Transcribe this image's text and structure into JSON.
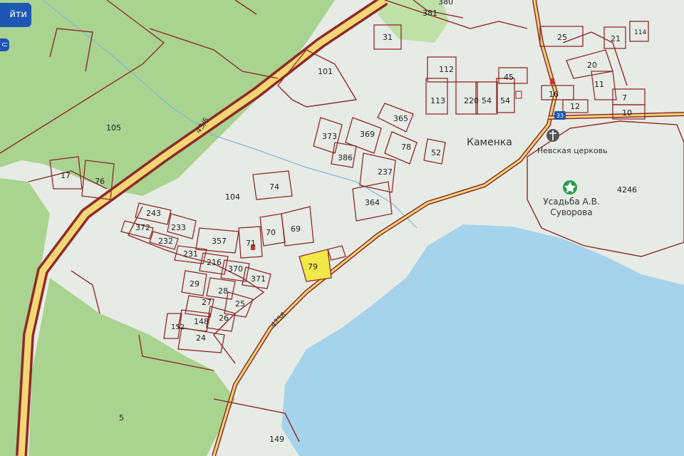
{
  "ui": {
    "top_button_label": "йти",
    "second_button_glyph": "⊂"
  },
  "map": {
    "village_label": "Каменка",
    "church_label": "Невская церковь",
    "estate_label_line1": "Усадьба А.В.",
    "estate_label_line2": "Суворова",
    "road_label": "43/5",
    "road_lower_label": "4258",
    "road_badge": "33",
    "plots": {
      "p380": "380",
      "p381": "381",
      "p31": "31",
      "p25": "25",
      "p21": "21",
      "p114": "114",
      "p101": "101",
      "p105": "105",
      "p112": "112",
      "p45": "45",
      "p20": "20",
      "p11": "11",
      "p113": "113",
      "p220": "220",
      "p54a": "54",
      "p54b": "54",
      "p16": "16",
      "p12": "12",
      "p7": "7",
      "p10": "10",
      "p365": "365",
      "p373": "373",
      "p369": "369",
      "p78": "78",
      "p386": "386",
      "p52": "52",
      "p237": "237",
      "p4246": "4246",
      "p17": "17",
      "p76": "76",
      "p104": "104",
      "p74": "74",
      "p364": "364",
      "p243": "243",
      "p233": "233",
      "p372": "372",
      "p232": "232",
      "p357": "357",
      "p70": "70",
      "p69": "69",
      "p71": "71",
      "p231": "231",
      "p216": "216",
      "p370": "370",
      "p371": "371",
      "p79": "79",
      "p29": "29",
      "p28": "28",
      "p27": "27",
      "p25b": "25",
      "p26": "26",
      "p148": "148",
      "p152": "152",
      "p24": "24",
      "p5": "5",
      "p149": "149"
    }
  },
  "colors": {
    "forest": "#a9d490",
    "open_land": "#e7ebe5",
    "lake": "#a6d3ec",
    "parcel_border": "#8e2a2a",
    "road_fill": "#f3d774",
    "highlight_parcel": "#f1e94a",
    "button": "#1e56b3",
    "icon_green": "#2e9c4f"
  }
}
